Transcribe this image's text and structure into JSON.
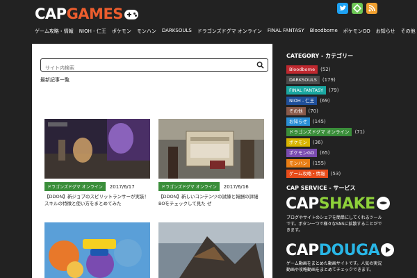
{
  "header": {
    "logo_part1": "CAP",
    "logo_part2": "GAMES",
    "social": [
      {
        "icon": "twitter-icon",
        "glyph": "t",
        "color": "#1da1f2"
      },
      {
        "icon": "feedly-icon",
        "glyph": "f",
        "color": "#6cc655"
      },
      {
        "icon": "rss-icon",
        "glyph": "r",
        "color": "#f0a030"
      }
    ]
  },
  "nav": {
    "items": [
      "ゲーム攻略・情報",
      "NIOH - 仁王",
      "ポケモン",
      "モンハン",
      "DARKSOULS",
      "ドラゴンズドグマ オンライン",
      "FINAL FANTASY",
      "Bloodborne",
      "ポケモンGO",
      "お知らせ",
      "その他"
    ]
  },
  "search": {
    "placeholder": "サイト内検索"
  },
  "main": {
    "section_title": "最新記事一覧"
  },
  "posts": [
    {
      "tag": "ドラゴンズドグマ オンライン",
      "date": "2017/6/17",
      "title": "【DDON】新ジョブのスピリットランサーが実装！スキルの特徴と使い方をまとめてみた",
      "tag_color": "#3a8e3a"
    },
    {
      "tag": "ドラゴンズドグマ オンライン",
      "date": "2017/6/16",
      "title": "【DDON】新しいコンテンツの試練と報酬の詳細BOをチェックして見た ぜ",
      "tag_color": "#3a8e3a"
    },
    {
      "tag": "",
      "date": "",
      "title": "",
      "tag_color": "#3a8e3a"
    },
    {
      "tag": "",
      "date": "",
      "title": "",
      "tag_color": "#3a8e3a"
    }
  ],
  "sidebar": {
    "category_title": "CATEGORY - カテゴリー",
    "categories": [
      {
        "name": "Bloodborne",
        "count": "(52)",
        "color": "#c0282f"
      },
      {
        "name": "DARKSOULS",
        "count": "(179)",
        "color": "#4a4a4a"
      },
      {
        "name": "FINAL FANTASY",
        "count": "(79)",
        "color": "#1aa7a1"
      },
      {
        "name": "NIOH - 仁王",
        "count": "(69)",
        "color": "#1f4f9a"
      },
      {
        "name": "その他",
        "count": "(70)",
        "color": "#8a5a4a"
      },
      {
        "name": "お知らせ",
        "count": "(145)",
        "color": "#2a8fd6"
      },
      {
        "name": "ドラゴンズドグマ オンライン",
        "count": "(71)",
        "color": "#3a8e3a"
      },
      {
        "name": "ポケモン",
        "count": "(36)",
        "color": "#d8b400"
      },
      {
        "name": "ポケモンGO",
        "count": "(65)",
        "color": "#7a4bb0"
      },
      {
        "name": "モンハン",
        "count": "(155)",
        "color": "#e87d14"
      },
      {
        "name": "ゲーム攻略・情報",
        "count": "(53)",
        "color": "#e84c1a"
      }
    ],
    "service_title": "CAP SERVICE - サービス",
    "services": [
      {
        "part1": "CAP",
        "part2": "SHAKE",
        "part2_color": "#8ed13a",
        "desc": "ブログやサイトのシェアを簡単にしてくれるツールです。ボタン一つで様々なSNSに拡散することができます。"
      },
      {
        "part1": "CAP",
        "part2": "DOUGA",
        "part2_color": "#29b6e6",
        "desc": "ゲーム動画をまとめた動画サイトです。人気の実況動画や攻略動画をまとめてチェックできます。"
      }
    ]
  }
}
